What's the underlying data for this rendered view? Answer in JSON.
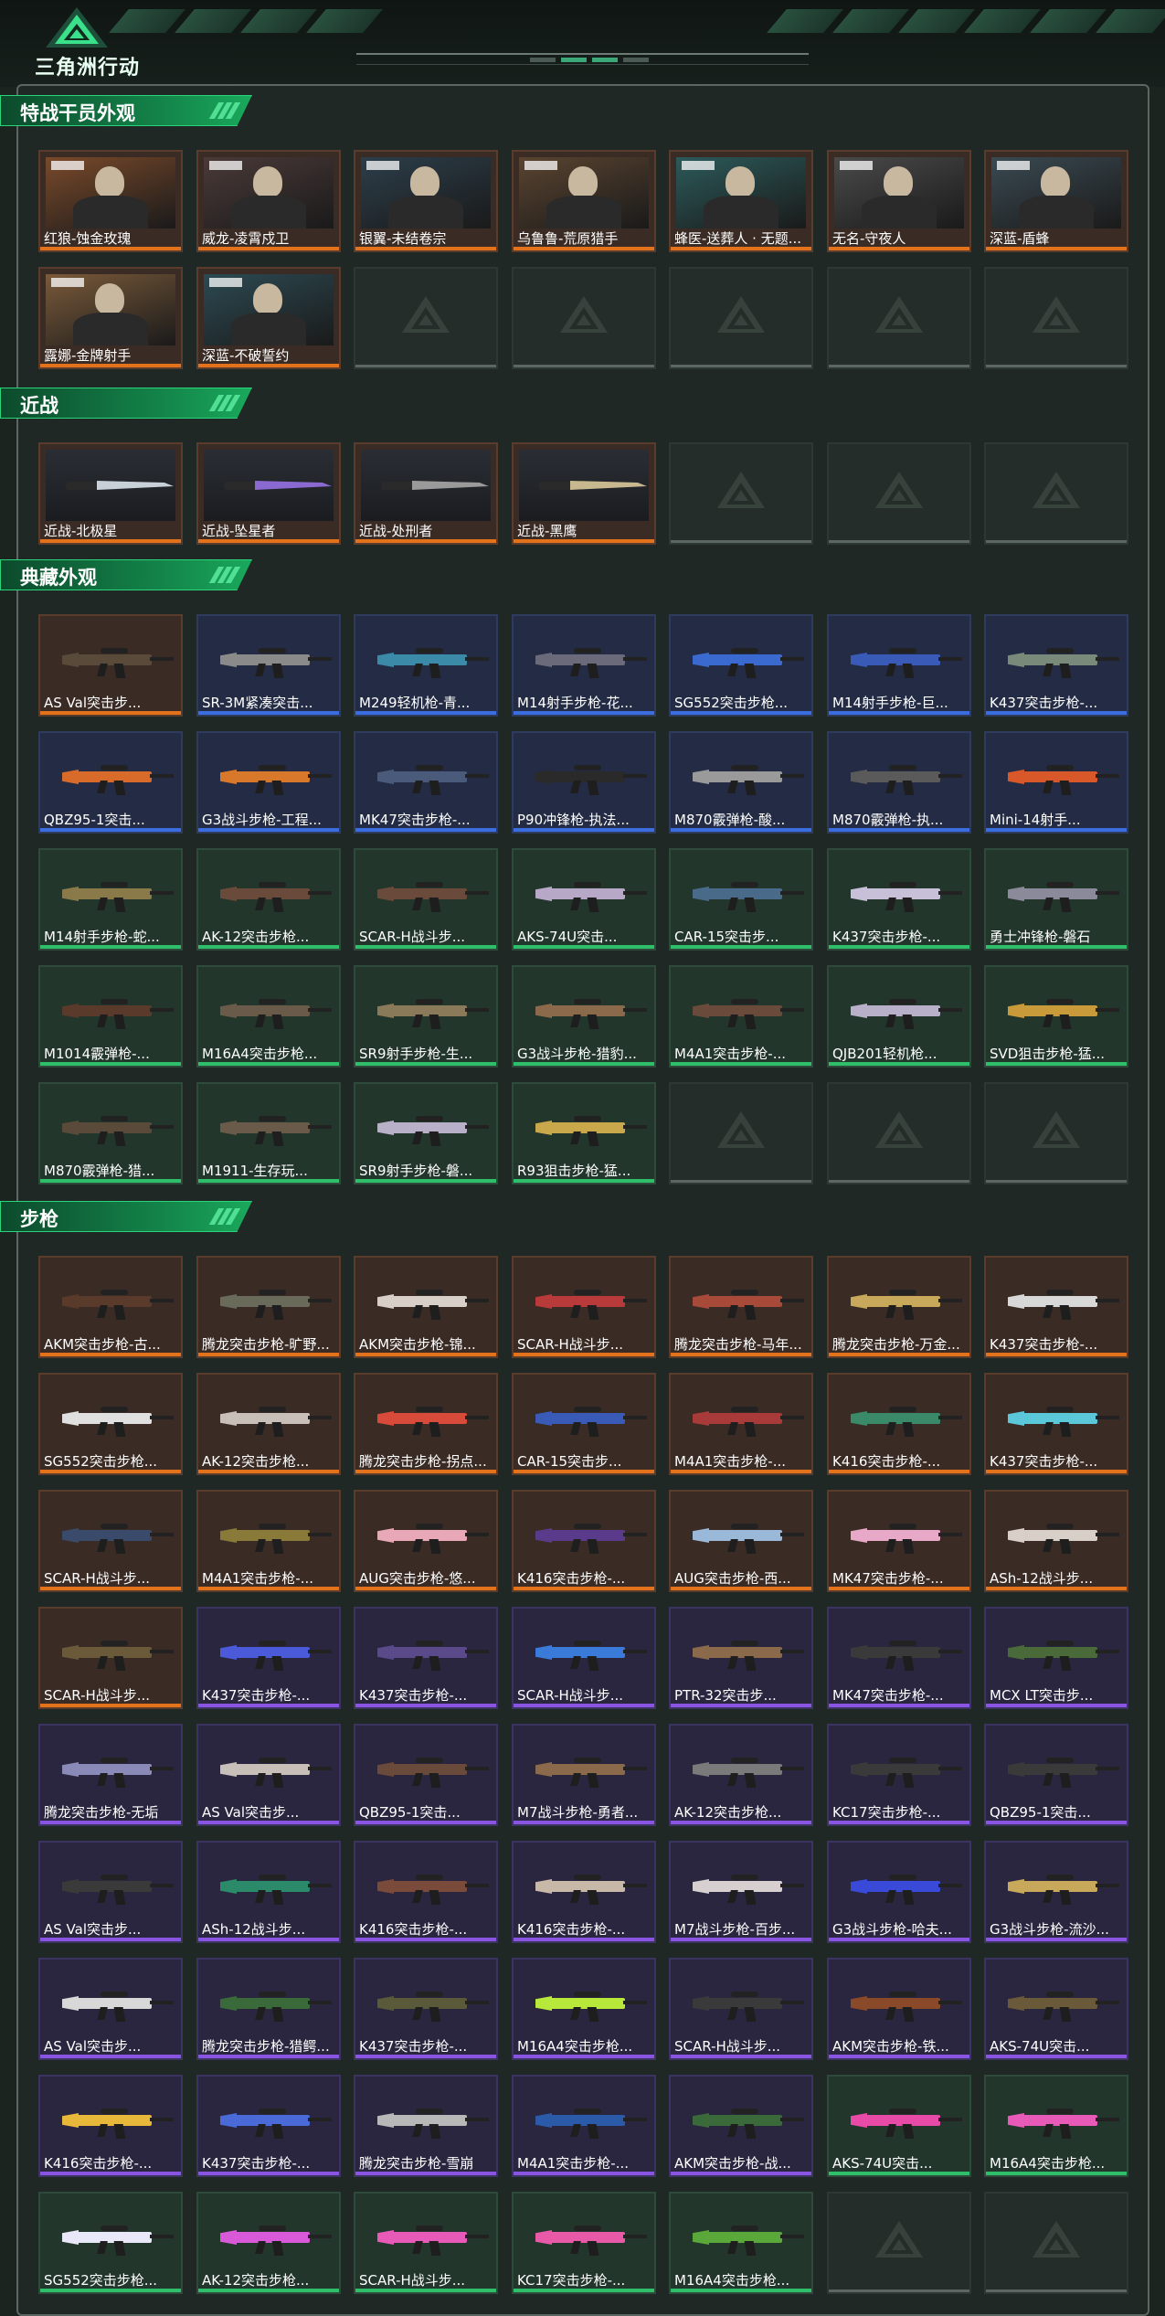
{
  "app": {
    "title": "三角洲行动",
    "logo_icon": "delta-triangle-logo-icon"
  },
  "colors": {
    "accent": "#1aa95c",
    "rarity_orange": "#e3721c",
    "rarity_blue": "#3a6de0",
    "rarity_green": "#2fbf6a",
    "rarity_purple": "#8a54e3"
  },
  "sections": [
    {
      "title": "特战干员外观",
      "kind": "operator",
      "items": [
        {
          "name": "红狼-蚀金玫瑰",
          "rarity": "orange",
          "tint": "#7a4a2a"
        },
        {
          "name": "威龙-凌霄戍卫",
          "rarity": "orange",
          "tint": "#4a3a38"
        },
        {
          "name": "银翼-未结卷宗",
          "rarity": "orange",
          "tint": "#2c3e4a"
        },
        {
          "name": "乌鲁鲁-荒原猎手",
          "rarity": "orange",
          "tint": "#5a4430"
        },
        {
          "name": "蜂医-送葬人 · 无题...",
          "rarity": "orange",
          "tint": "#2c5a5a"
        },
        {
          "name": "无名-守夜人",
          "rarity": "orange",
          "tint": "#4a4a4a"
        },
        {
          "name": "深蓝-盾蜂",
          "rarity": "orange",
          "tint": "#3a4a52"
        },
        {
          "name": "露娜-金牌射手",
          "rarity": "orange",
          "tint": "#7a5a3a"
        },
        {
          "name": "深蓝-不破誓约",
          "rarity": "orange",
          "tint": "#2c4a52"
        },
        {
          "empty": true
        },
        {
          "empty": true
        },
        {
          "empty": true
        },
        {
          "empty": true
        },
        {
          "empty": true
        }
      ]
    },
    {
      "title": "近战",
      "kind": "melee",
      "items": [
        {
          "name": "近战-北极星",
          "rarity": "orange",
          "tint": "#c8d0d8"
        },
        {
          "name": "近战-坠星者",
          "rarity": "orange",
          "tint": "#8a6ad0"
        },
        {
          "name": "近战-处刑者",
          "rarity": "orange",
          "tint": "#9a9a9a"
        },
        {
          "name": "近战-黑鹰",
          "rarity": "orange",
          "tint": "#c8b890"
        },
        {
          "empty": true
        },
        {
          "empty": true
        },
        {
          "empty": true
        }
      ]
    },
    {
      "title": "典藏外观",
      "kind": "weapon",
      "items": [
        {
          "name": "AS Val突击步...",
          "rarity": "orange",
          "tint": "#5a4a3a"
        },
        {
          "name": "SR-3M紧凑突击...",
          "rarity": "blue",
          "tint": "#8a8a8a"
        },
        {
          "name": "M249轻机枪-青...",
          "rarity": "blue",
          "tint": "#3a8aa8"
        },
        {
          "name": "M14射手步枪-花...",
          "rarity": "blue",
          "tint": "#6a6a7a"
        },
        {
          "name": "SG552突击步枪...",
          "rarity": "blue",
          "tint": "#3a6ad0"
        },
        {
          "name": "M14射手步枪-巨...",
          "rarity": "blue",
          "tint": "#3a5ab8"
        },
        {
          "name": "K437突击步枪-...",
          "rarity": "blue",
          "tint": "#7a8a7a"
        },
        {
          "name": "QBZ95-1突击...",
          "rarity": "blue",
          "tint": "#d86a2a"
        },
        {
          "name": "G3战斗步枪-工程...",
          "rarity": "blue",
          "tint": "#d8782a"
        },
        {
          "name": "MK47突击步枪-...",
          "rarity": "blue",
          "tint": "#4a5a7a"
        },
        {
          "name": "P90冲锋枪-执法...",
          "rarity": "blue",
          "tint": "#2a2a2a"
        },
        {
          "name": "M870霰弹枪-酸...",
          "rarity": "blue",
          "tint": "#9a9a9a"
        },
        {
          "name": "M870霰弹枪-执...",
          "rarity": "blue",
          "tint": "#5a5a5a"
        },
        {
          "name": "Mini-14射手...",
          "rarity": "blue",
          "tint": "#d8582a"
        },
        {
          "name": "M14射手步枪-蛇...",
          "rarity": "green",
          "tint": "#8a7a4a"
        },
        {
          "name": "AK-12突击步枪...",
          "rarity": "green",
          "tint": "#6a4a3a"
        },
        {
          "name": "SCAR-H战斗步...",
          "rarity": "green",
          "tint": "#6a4a3a"
        },
        {
          "name": "AKS-74U突击...",
          "rarity": "green",
          "tint": "#b8a8c8"
        },
        {
          "name": "CAR-15突击步...",
          "rarity": "green",
          "tint": "#4a6a8a"
        },
        {
          "name": "K437突击步枪-...",
          "rarity": "green",
          "tint": "#c8c0d8"
        },
        {
          "name": "勇士冲锋枪-磐石",
          "rarity": "green",
          "tint": "#8a8a9a"
        },
        {
          "name": "M1014霰弹枪-...",
          "rarity": "green",
          "tint": "#5a3a2a"
        },
        {
          "name": "M16A4突击步枪...",
          "rarity": "green",
          "tint": "#6a5a4a"
        },
        {
          "name": "SR9射手步枪-生...",
          "rarity": "green",
          "tint": "#8a7a5a"
        },
        {
          "name": "G3战斗步枪-猎豹...",
          "rarity": "green",
          "tint": "#8a6a4a"
        },
        {
          "name": "M4A1突击步枪-...",
          "rarity": "green",
          "tint": "#6a4a3a"
        },
        {
          "name": "QJB201轻机枪...",
          "rarity": "green",
          "tint": "#b8b0c8"
        },
        {
          "name": "SVD狙击步枪-猛...",
          "rarity": "green",
          "tint": "#c89a3a"
        },
        {
          "name": "M870霰弹枪-猎...",
          "rarity": "green",
          "tint": "#5a4a3a"
        },
        {
          "name": "M1911-生存玩...",
          "rarity": "green",
          "tint": "#6a5a4a"
        },
        {
          "name": "SR9射手步枪-磐...",
          "rarity": "green",
          "tint": "#b8b0c8"
        },
        {
          "name": "R93狙击步枪-猛...",
          "rarity": "green",
          "tint": "#c8a84a"
        },
        {
          "empty": true
        },
        {
          "empty": true
        },
        {
          "empty": true
        }
      ]
    },
    {
      "title": "步枪",
      "kind": "weapon",
      "items": [
        {
          "name": "AKM突击步枪-古...",
          "rarity": "orange",
          "tint": "#5a3a2a"
        },
        {
          "name": "腾龙突击步枪-旷野...",
          "rarity": "orange",
          "tint": "#6a6a5a"
        },
        {
          "name": "AKM突击步枪-锦...",
          "rarity": "orange",
          "tint": "#d8d0c8"
        },
        {
          "name": "SCAR-H战斗步...",
          "rarity": "orange",
          "tint": "#b83a3a"
        },
        {
          "name": "腾龙突击步枪-马年...",
          "rarity": "orange",
          "tint": "#a84a3a"
        },
        {
          "name": "腾龙突击步枪-万金...",
          "rarity": "orange",
          "tint": "#c8a85a"
        },
        {
          "name": "K437突击步枪-...",
          "rarity": "orange",
          "tint": "#d8d8d8"
        },
        {
          "name": "SG552突击步枪...",
          "rarity": "orange",
          "tint": "#e0e0e0"
        },
        {
          "name": "AK-12突击步枪...",
          "rarity": "orange",
          "tint": "#c8c0b8"
        },
        {
          "name": "腾龙突击步枪-拐点...",
          "rarity": "orange",
          "tint": "#d84a3a"
        },
        {
          "name": "CAR-15突击步...",
          "rarity": "orange",
          "tint": "#3a5ab8"
        },
        {
          "name": "M4A1突击步枪-...",
          "rarity": "orange",
          "tint": "#a83a3a"
        },
        {
          "name": "K416突击步枪-...",
          "rarity": "orange",
          "tint": "#3a8a6a"
        },
        {
          "name": "K437突击步枪-...",
          "rarity": "orange",
          "tint": "#5ac8d8"
        },
        {
          "name": "SCAR-H战斗步...",
          "rarity": "orange",
          "tint": "#3a4a6a"
        },
        {
          "name": "M4A1突击步枪-...",
          "rarity": "orange",
          "tint": "#8a7a3a"
        },
        {
          "name": "AUG突击步枪-悠...",
          "rarity": "orange",
          "tint": "#e8a8b8"
        },
        {
          "name": "K416突击步枪-...",
          "rarity": "orange",
          "tint": "#5a3a8a"
        },
        {
          "name": "AUG突击步枪-西...",
          "rarity": "orange",
          "tint": "#9ab8d8"
        },
        {
          "name": "MK47突击步枪-...",
          "rarity": "orange",
          "tint": "#e8a8c8"
        },
        {
          "name": "ASh-12战斗步...",
          "rarity": "orange",
          "tint": "#d8d0c8"
        },
        {
          "name": "SCAR-H战斗步...",
          "rarity": "orange",
          "tint": "#6a5a3a"
        },
        {
          "name": "K437突击步枪-...",
          "rarity": "purple",
          "tint": "#4a5ad8"
        },
        {
          "name": "K437突击步枪-...",
          "rarity": "purple",
          "tint": "#5a4a8a"
        },
        {
          "name": "SCAR-H战斗步...",
          "rarity": "purple",
          "tint": "#3a7ad8"
        },
        {
          "name": "PTR-32突击步...",
          "rarity": "purple",
          "tint": "#8a6a4a"
        },
        {
          "name": "MK47突击步枪-...",
          "rarity": "purple",
          "tint": "#3a3a3a"
        },
        {
          "name": "MCX LT突击步...",
          "rarity": "purple",
          "tint": "#4a6a3a"
        },
        {
          "name": "腾龙突击步枪-无垢",
          "rarity": "purple",
          "tint": "#8a8ab8"
        },
        {
          "name": "AS Val突击步...",
          "rarity": "purple",
          "tint": "#c8c0b8"
        },
        {
          "name": "QBZ95-1突击...",
          "rarity": "purple",
          "tint": "#6a4a3a"
        },
        {
          "name": "M7战斗步枪-勇者...",
          "rarity": "purple",
          "tint": "#8a6a4a"
        },
        {
          "name": "AK-12突击步枪...",
          "rarity": "purple",
          "tint": "#7a7a7a"
        },
        {
          "name": "KC17突击步枪-...",
          "rarity": "purple",
          "tint": "#3a3a3a"
        },
        {
          "name": "QBZ95-1突击...",
          "rarity": "purple",
          "tint": "#3a3a3a"
        },
        {
          "name": "AS Val突击步...",
          "rarity": "purple",
          "tint": "#3a3a3a"
        },
        {
          "name": "ASh-12战斗步...",
          "rarity": "purple",
          "tint": "#2a8a6a"
        },
        {
          "name": "K416突击步枪-...",
          "rarity": "purple",
          "tint": "#7a4a3a"
        },
        {
          "name": "K416突击步枪-...",
          "rarity": "purple",
          "tint": "#c8b8a8"
        },
        {
          "name": "M7战斗步枪-百步...",
          "rarity": "purple",
          "tint": "#d8d0d0"
        },
        {
          "name": "G3战斗步枪-哈夫...",
          "rarity": "purple",
          "tint": "#3a4ad8"
        },
        {
          "name": "G3战斗步枪-流沙...",
          "rarity": "purple",
          "tint": "#c8a85a"
        },
        {
          "name": "AS Val突击步...",
          "rarity": "purple",
          "tint": "#d8d8d8"
        },
        {
          "name": "腾龙突击步枪-猎鳄...",
          "rarity": "purple",
          "tint": "#3a6a3a"
        },
        {
          "name": "K437突击步枪-...",
          "rarity": "purple",
          "tint": "#5a5a3a"
        },
        {
          "name": "M16A4突击步枪...",
          "rarity": "purple",
          "tint": "#b8e83a"
        },
        {
          "name": "SCAR-H战斗步...",
          "rarity": "purple",
          "tint": "#3a3a3a"
        },
        {
          "name": "AKM突击步枪-铁...",
          "rarity": "purple",
          "tint": "#8a4a2a"
        },
        {
          "name": "AKS-74U突击...",
          "rarity": "purple",
          "tint": "#6a5a3a"
        },
        {
          "name": "K416突击步枪-...",
          "rarity": "purple",
          "tint": "#e8b83a"
        },
        {
          "name": "K437突击步枪-...",
          "rarity": "purple",
          "tint": "#4a6ad8"
        },
        {
          "name": "腾龙突击步枪-雪崩",
          "rarity": "purple",
          "tint": "#b8b8b8"
        },
        {
          "name": "M4A1突击步枪-...",
          "rarity": "purple",
          "tint": "#2a5aa8"
        },
        {
          "name": "AKM突击步枪-战...",
          "rarity": "purple",
          "tint": "#3a6a3a"
        },
        {
          "name": "AKS-74U突击...",
          "rarity": "green",
          "tint": "#e84aa8"
        },
        {
          "name": "M16A4突击步枪...",
          "rarity": "green",
          "tint": "#e85ab8"
        },
        {
          "name": "SG552突击步枪...",
          "rarity": "green",
          "tint": "#e8e8f8"
        },
        {
          "name": "AK-12突击步枪...",
          "rarity": "green",
          "tint": "#d85ad8"
        },
        {
          "name": "SCAR-H战斗步...",
          "rarity": "green",
          "tint": "#e85ab8"
        },
        {
          "name": "KC17突击步枪-...",
          "rarity": "green",
          "tint": "#e85aa8"
        },
        {
          "name": "M16A4突击步枪...",
          "rarity": "green",
          "tint": "#5aa83a"
        },
        {
          "empty": true
        },
        {
          "empty": true
        }
      ]
    }
  ]
}
